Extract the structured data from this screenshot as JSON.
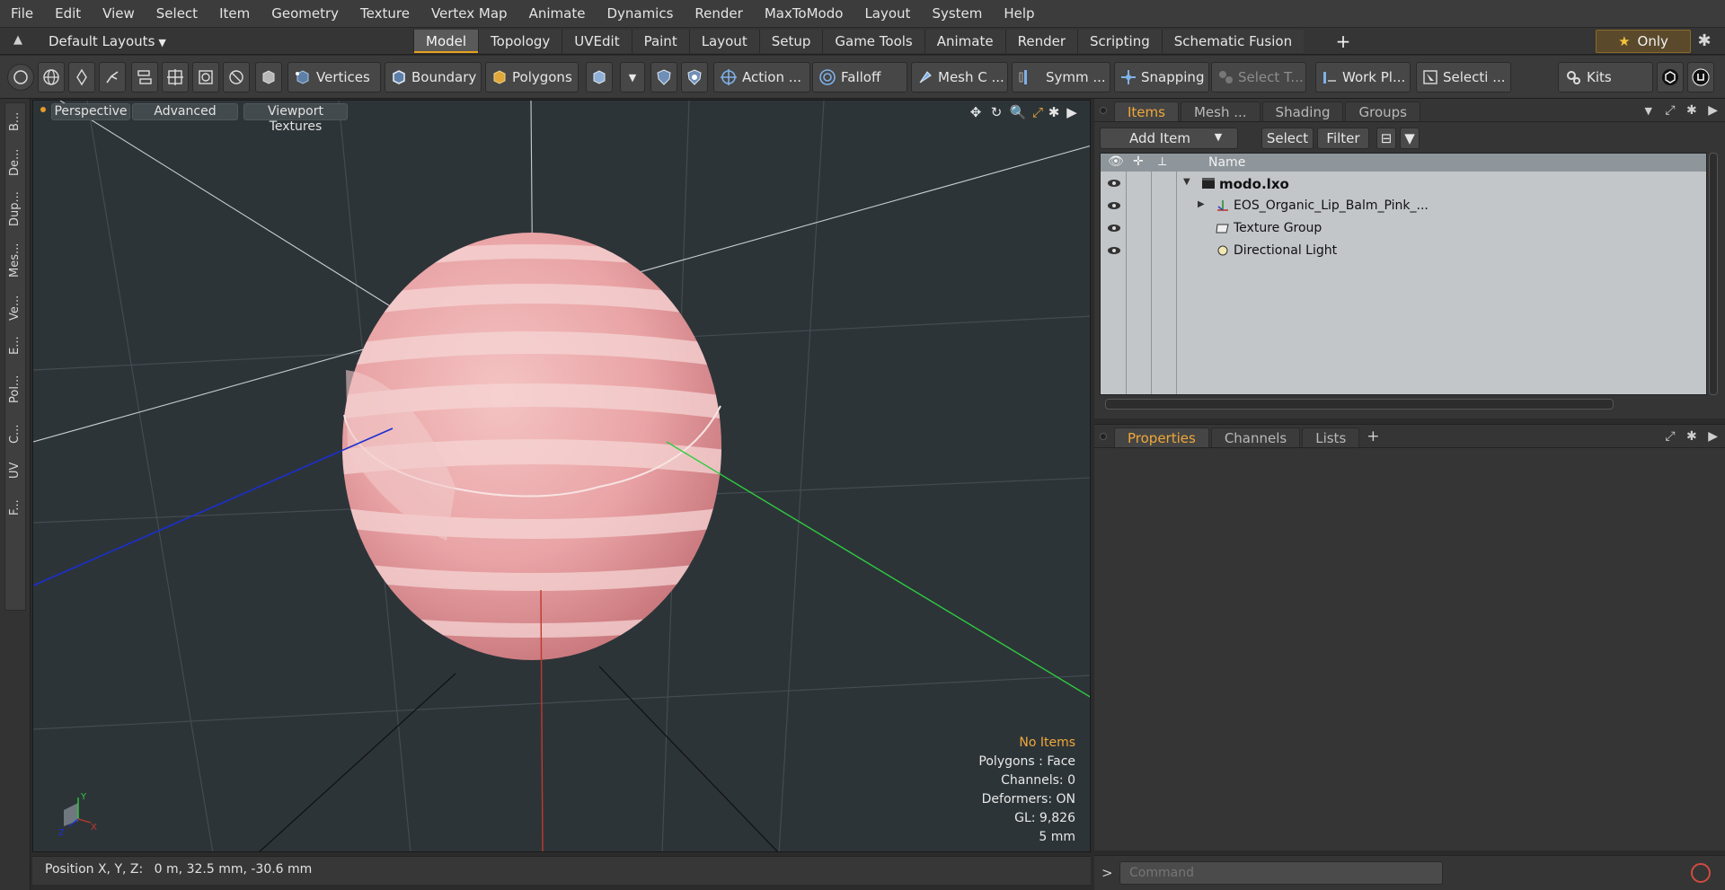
{
  "menu": [
    "File",
    "Edit",
    "View",
    "Select",
    "Item",
    "Geometry",
    "Texture",
    "Vertex Map",
    "Animate",
    "Dynamics",
    "Render",
    "MaxToModo",
    "Layout",
    "System",
    "Help"
  ],
  "layout": {
    "name": "Default Layouts",
    "only_label": "Only"
  },
  "mode_tabs": [
    "Model",
    "Topology",
    "UVEdit",
    "Paint",
    "Layout",
    "Setup",
    "Game Tools",
    "Animate",
    "Render",
    "Scripting",
    "Schematic Fusion"
  ],
  "active_tab": "Model",
  "toolbar": {
    "vertices": "Vertices",
    "boundary": "Boundary",
    "polygons": "Polygons",
    "action": "Action ...",
    "falloff": "Falloff",
    "mesh_constraints": "Mesh C ...",
    "symmetry": "Symm ...",
    "snapping": "Snapping",
    "select_through": "Select T...",
    "work_plane": "Work Pl...",
    "selection_sets": "Selecti ...",
    "kits": "Kits"
  },
  "left_tabs": [
    "B...",
    "De...",
    "Dup...",
    "Mes...",
    "Ve...",
    "E...",
    "Pol...",
    "C...",
    "UV",
    "F..."
  ],
  "viewport": {
    "view_mode": "Perspective",
    "shading": "Advanced",
    "textures": "Viewport Textures",
    "info": {
      "selection": "No Items",
      "polygons": "Polygons : Face",
      "channels": "Channels: 0",
      "deformers": "Deformers: ON",
      "gl": "GL: 9,826",
      "scale": "5 mm"
    },
    "axis_labels": {
      "y": "Y",
      "x": "X",
      "z": "Z"
    },
    "colors": {
      "x_axis": "#c0392b",
      "y_axis": "#2ecc40",
      "z_axis": "#1a2fd1",
      "object": "#efaeb0"
    }
  },
  "status": {
    "position_label": "Position X, Y, Z:",
    "position_value": "0 m, 32.5 mm, -30.6 mm"
  },
  "items_panel": {
    "tabs": [
      "Items",
      "Mesh ...",
      "Shading",
      "Groups"
    ],
    "active_tab": "Items",
    "add_item": "Add Item",
    "select": "Select",
    "filter": "Filter",
    "column_name": "Name",
    "tree": [
      {
        "label": "modo.lxo",
        "indent": 0,
        "icon": "scene-icon",
        "bold": true
      },
      {
        "label": "EOS_Organic_Lip_Balm_Pink_...",
        "indent": 1,
        "icon": "locator-icon",
        "bold": false
      },
      {
        "label": "Texture Group",
        "indent": 1,
        "icon": "texture-group-icon",
        "bold": false
      },
      {
        "label": "Directional Light",
        "indent": 1,
        "icon": "light-icon",
        "bold": false
      }
    ]
  },
  "props_panel": {
    "tabs": [
      "Properties",
      "Channels",
      "Lists"
    ],
    "active_tab": "Properties"
  },
  "command": {
    "placeholder": "Command"
  }
}
